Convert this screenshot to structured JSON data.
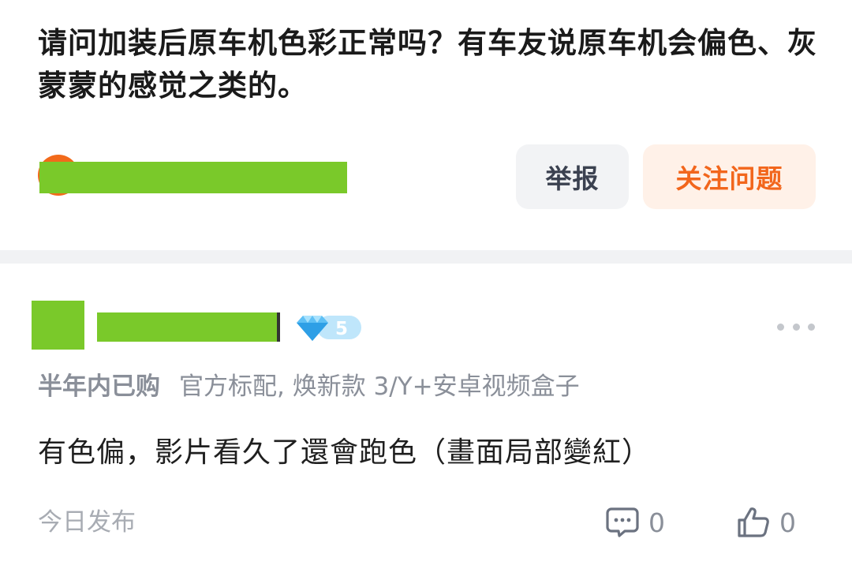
{
  "question": {
    "title": "请问加装后原车机色彩正常吗？有车友说原车机会偏色、灰蒙蒙的感觉之类的。"
  },
  "question_actions": {
    "report_label": "举报",
    "follow_label": "关注问题"
  },
  "answer": {
    "level": "5",
    "purchase_tag": "半年内已购",
    "product_spec": "官方标配, 焕新款 3/Y+安卓视频盒子",
    "content": "有色偏，影片看久了還會跑色（畫面局部變紅）",
    "posted_time": "今日发布",
    "comment_count": "0",
    "like_count": "0"
  },
  "colors": {
    "accent_orange": "#f2661c",
    "redaction_green": "#7ac92a",
    "diamond_blue": "#5fc0f5"
  },
  "icons": [
    "more-icon",
    "diamond-level-icon",
    "comment-icon",
    "thumbs-up-icon"
  ]
}
